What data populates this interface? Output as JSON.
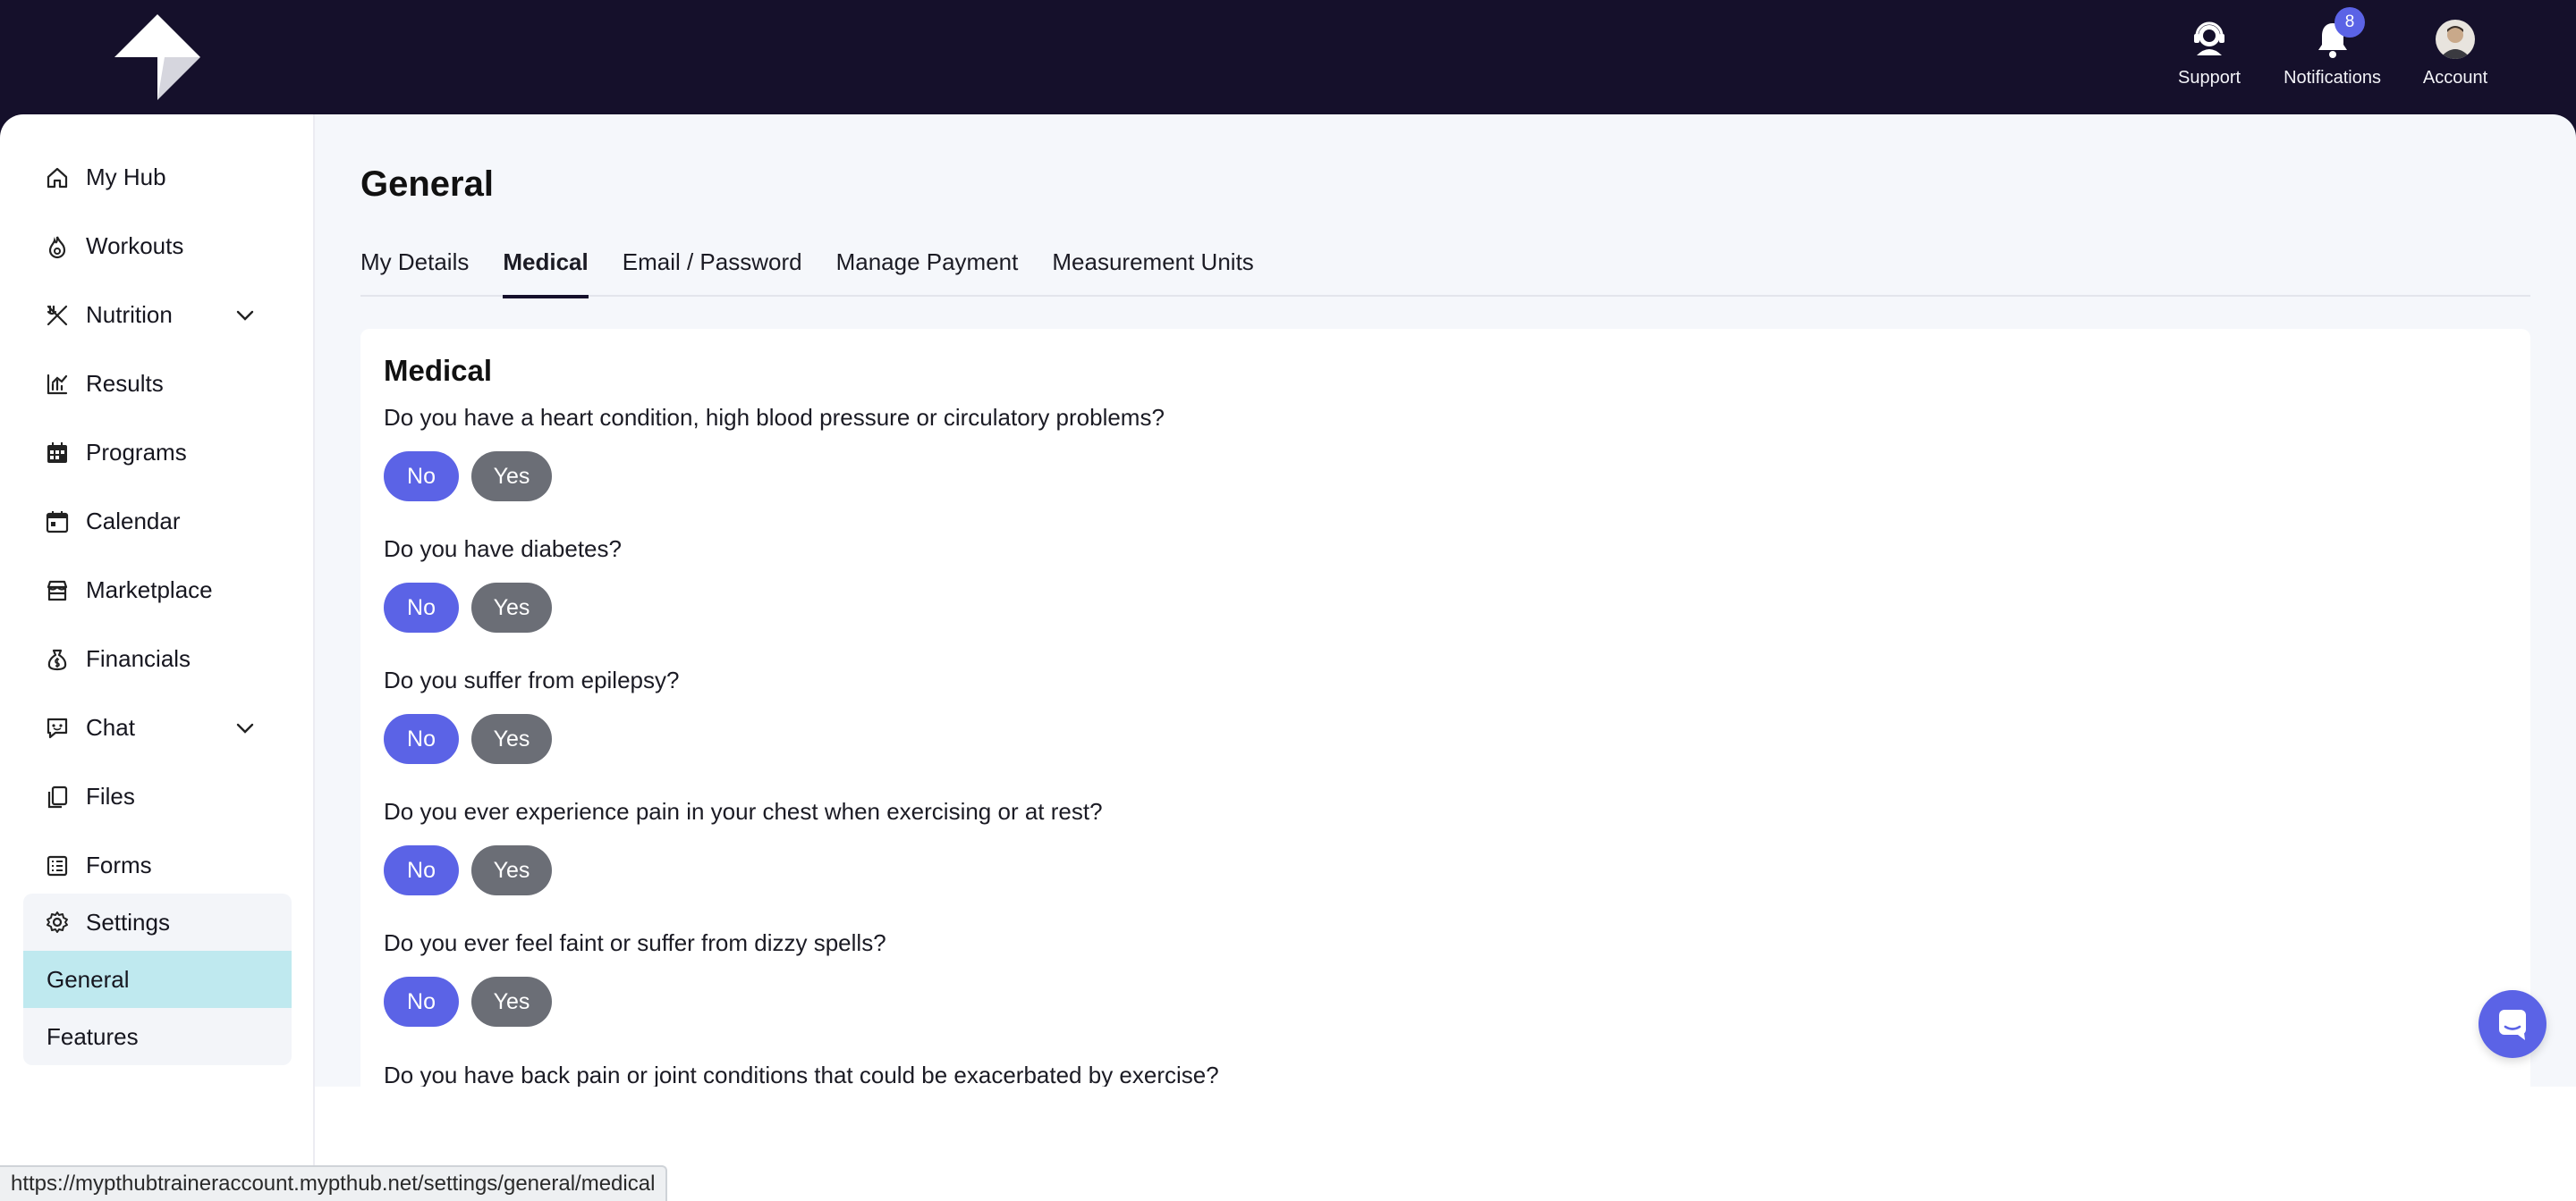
{
  "header": {
    "support_label": "Support",
    "notifications_label": "Notifications",
    "notifications_count": "8",
    "account_label": "Account"
  },
  "sidebar": {
    "items": [
      {
        "label": "My Hub",
        "icon": "home-icon"
      },
      {
        "label": "Workouts",
        "icon": "flame-icon"
      },
      {
        "label": "Nutrition",
        "icon": "utensils-icon",
        "expandable": true
      },
      {
        "label": "Results",
        "icon": "chart-icon"
      },
      {
        "label": "Programs",
        "icon": "calendar-grid-icon"
      },
      {
        "label": "Calendar",
        "icon": "calendar-icon"
      },
      {
        "label": "Marketplace",
        "icon": "store-icon"
      },
      {
        "label": "Financials",
        "icon": "money-bag-icon"
      },
      {
        "label": "Chat",
        "icon": "chat-icon",
        "expandable": true
      },
      {
        "label": "Files",
        "icon": "files-icon"
      },
      {
        "label": "Forms",
        "icon": "form-icon"
      }
    ],
    "settings": {
      "label": "Settings",
      "sub_items": [
        "General",
        "Features"
      ],
      "active": "General"
    }
  },
  "main": {
    "title": "General",
    "tabs": [
      "My Details",
      "Medical",
      "Email / Password",
      "Manage Payment",
      "Measurement Units"
    ],
    "active_tab": "Medical",
    "card_title": "Medical",
    "questions": [
      "Do you have a heart condition, high blood pressure or circulatory problems?",
      "Do you have diabetes?",
      "Do you suffer from epilepsy?",
      "Do you ever experience pain in your chest when exercising or at rest?",
      "Do you ever feel faint or suffer from dizzy spells?",
      "Do you have back pain or joint conditions that could be exacerbated by exercise?"
    ],
    "no_label": "No",
    "yes_label": "Yes",
    "selected_answer": "No"
  },
  "status_url": "https://mypthubtraineraccount.mypthub.net/settings/general/medical",
  "colors": {
    "header_bg": "#15102b",
    "accent": "#5b63e6",
    "yes_button": "#6b6e76",
    "active_sub_item": "#bfe9ef"
  }
}
